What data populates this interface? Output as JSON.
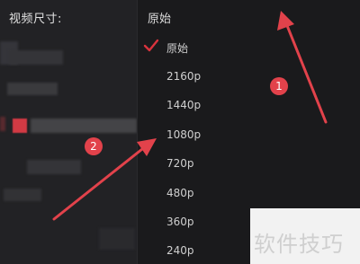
{
  "settings": {
    "size_label": "视频尺寸:"
  },
  "dropdown": {
    "selected_value": "原始",
    "options": [
      {
        "label": "原始",
        "checked": true
      },
      {
        "label": "2160p",
        "checked": false
      },
      {
        "label": "1440p",
        "checked": false
      },
      {
        "label": "1080p",
        "checked": false
      },
      {
        "label": "720p",
        "checked": false
      },
      {
        "label": "480p",
        "checked": false
      },
      {
        "label": "360p",
        "checked": false
      },
      {
        "label": "240p",
        "checked": false
      }
    ]
  },
  "annotations": {
    "badge1": "1",
    "badge2": "2"
  },
  "watermark": {
    "text": "软件技巧"
  },
  "colors": {
    "accent": "#e2424b",
    "check": "#d9333d",
    "panel": "#222225",
    "dropdown": "#1a1a1c"
  }
}
